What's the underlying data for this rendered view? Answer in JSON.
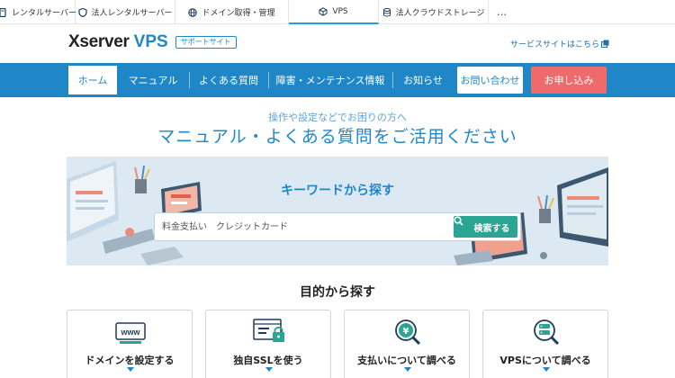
{
  "top_tabs": [
    {
      "label": "レンタルサーバー",
      "icon": "server-icon"
    },
    {
      "label": "法人レンタルサーバー",
      "icon": "shield-icon"
    },
    {
      "label": "ドメイン取得・管理",
      "icon": "globe-icon"
    },
    {
      "label": "VPS",
      "icon": "cube-icon",
      "active": true
    },
    {
      "label": "法人クラウドストレージ",
      "icon": "database-icon"
    },
    {
      "label": "…",
      "icon": "more-icon"
    }
  ],
  "header": {
    "logo_main": "Xserver",
    "logo_sub": "VPS",
    "support_badge": "サポートサイト",
    "service_link": "サービスサイトはこちら"
  },
  "nav": {
    "items": [
      "ホーム",
      "マニュアル",
      "よくある質問",
      "障害・メンテナンス情報",
      "お知らせ"
    ],
    "active_index": 0,
    "contact": "お問い合わせ",
    "apply": "お申し込み"
  },
  "hero": {
    "subtitle": "操作や設定などでお困りの方へ",
    "title": "マニュアル・よくある質問をご活用ください"
  },
  "search": {
    "title": "キーワードから探す",
    "placeholder": "料金支払い　クレジットカード",
    "button": "検索する"
  },
  "purpose": {
    "title": "目的から探す",
    "cards": [
      {
        "label": "ドメインを設定する",
        "icon": "www-icon"
      },
      {
        "label": "独自SSLを使う",
        "icon": "ssl-lock-icon"
      },
      {
        "label": "支払いについて調べる",
        "icon": "yen-search-icon"
      },
      {
        "label": "VPSについて調べる",
        "icon": "server-search-icon"
      }
    ]
  },
  "colors": {
    "brand_blue": "#1f87c8",
    "apply_red": "#ef6b6b",
    "search_green": "#2aa594",
    "banner_bg": "#dce9f3"
  }
}
